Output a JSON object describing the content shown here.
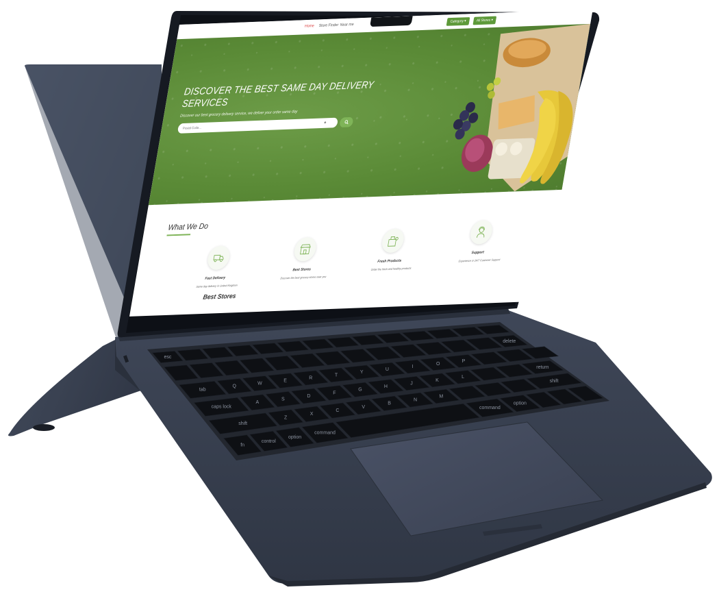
{
  "nav": {
    "links": [
      "Home",
      "Store Finder",
      "Near me"
    ],
    "category_btn": "Category ▾",
    "all_stores_btn": "All Stores ▾"
  },
  "hero": {
    "title": "DISCOVER THE BEST SAME DAY DELIVERY SERVICES",
    "subtitle": "Discover our best grocery delivery service, we deliver your order same day",
    "search_placeholder": "Postal Code...",
    "search_icon": "search-icon",
    "locate_icon": "crosshair-icon"
  },
  "what_we_do": {
    "title": "What We Do",
    "items": [
      {
        "icon": "delivery-truck-icon",
        "title": "Fast Delivery",
        "desc": "Same day delivery in United Kingdom"
      },
      {
        "icon": "storefront-icon",
        "title": "Best Stores",
        "desc": "Discover the best grocery stores near you"
      },
      {
        "icon": "grocery-bag-icon",
        "title": "Fresh Products",
        "desc": "Order the fresh and healthy products"
      },
      {
        "icon": "support-agent-icon",
        "title": "Support",
        "desc": "Experience or 24/7 Customer Support"
      }
    ]
  },
  "best_stores": {
    "title": "Best Stores"
  },
  "keyboard": {
    "keys": {
      "esc": "esc",
      "delete": "delete",
      "return": "return",
      "caps": "caps lock",
      "shift_l": "shift",
      "shift_r": "shift",
      "fn": "fn",
      "control": "control",
      "option_l": "option",
      "command_l": "command",
      "command_r": "command",
      "option_r": "option",
      "tab": "tab"
    },
    "letters": {
      "row1": [
        "Q",
        "W",
        "E",
        "R",
        "T",
        "Y",
        "U",
        "I",
        "O",
        "P"
      ],
      "row2": [
        "A",
        "S",
        "D",
        "F",
        "G",
        "H",
        "J",
        "K",
        "L"
      ],
      "row3": [
        "Z",
        "X",
        "C",
        "V",
        "B",
        "N",
        "M"
      ]
    }
  },
  "colors": {
    "brand_green": "#5e9a3a",
    "accent_red": "#d94141",
    "laptop_body": "#3a4355"
  }
}
